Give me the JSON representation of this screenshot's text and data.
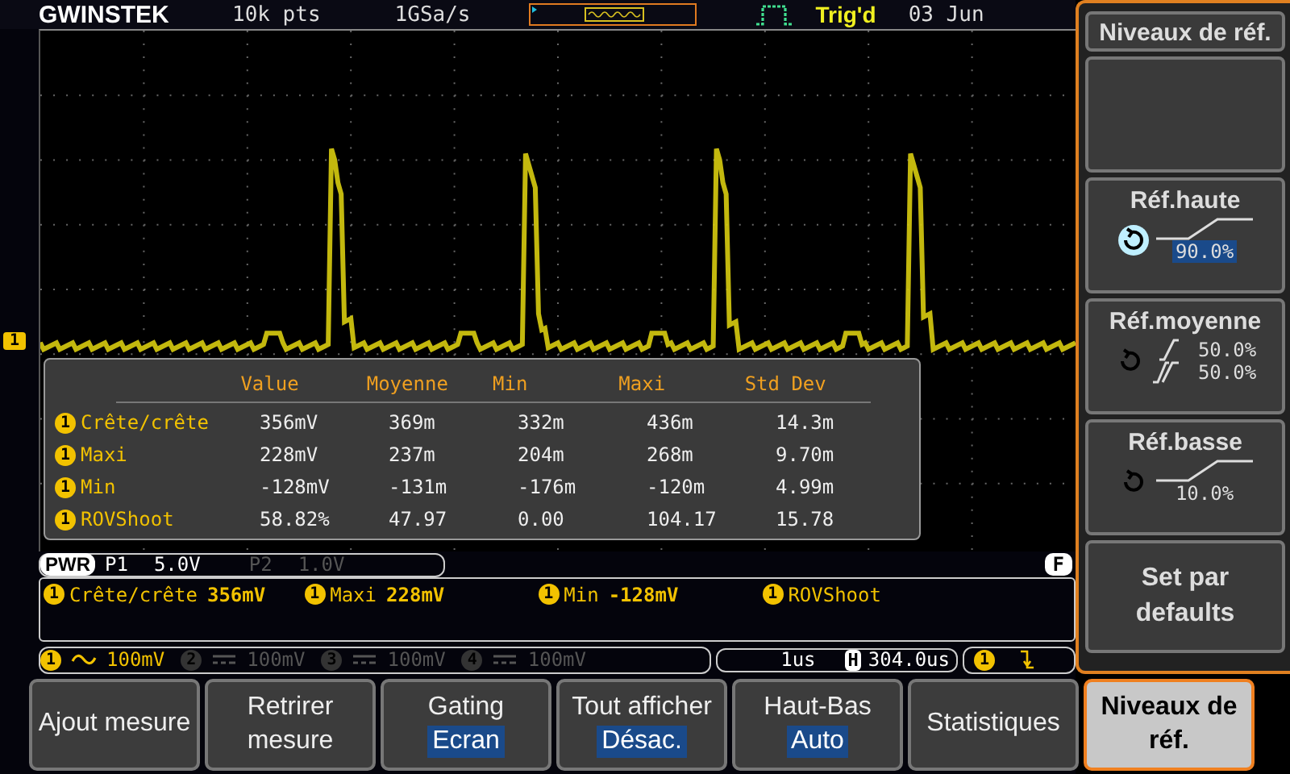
{
  "header": {
    "logo": "GWINSTEK",
    "record": "10k pts",
    "rate": "1GSa/s",
    "trigger_status": "Trig'd",
    "date": "03 Jun"
  },
  "plot": {
    "channel_marker": "1"
  },
  "table": {
    "columns": [
      "Value",
      "Moyenne",
      "Min",
      "Maxi",
      "Std Dev"
    ],
    "rows": [
      {
        "channel": "1",
        "name": "Crête/crête",
        "values": [
          "356mV",
          "369m",
          "332m",
          "436m",
          "14.3m"
        ]
      },
      {
        "channel": "1",
        "name": "Maxi",
        "values": [
          "228mV",
          "237m",
          "204m",
          "268m",
          "9.70m"
        ]
      },
      {
        "channel": "1",
        "name": "Min",
        "values": [
          "-128mV",
          "-131m",
          "-176m",
          "-120m",
          "4.99m"
        ]
      },
      {
        "channel": "1",
        "name": "ROVShoot",
        "values": [
          "58.82%",
          "47.97",
          "0.00",
          "104.17",
          "15.78"
        ]
      }
    ]
  },
  "power": {
    "label": "PWR",
    "probes": [
      {
        "name": "P1",
        "value": "5.0V",
        "disabled": false
      },
      {
        "name": "P2",
        "value": "1.0V",
        "disabled": true
      }
    ],
    "badge": "F"
  },
  "measure_strip": [
    {
      "channel": "1",
      "name": "Crête/crête",
      "value": "356mV"
    },
    {
      "channel": "1",
      "name": "Maxi",
      "value": "228mV"
    },
    {
      "channel": "1",
      "name": "Min",
      "value": "-128mV"
    },
    {
      "channel": "1",
      "name": "ROVShoot"
    }
  ],
  "channels": [
    {
      "number": "1",
      "scale": "100mV",
      "on": true,
      "kind": "ac"
    },
    {
      "number": "2",
      "scale": "100mV",
      "on": false,
      "kind": "dc"
    },
    {
      "number": "3",
      "scale": "100mV",
      "on": false,
      "kind": "dc"
    },
    {
      "number": "4",
      "scale": "100mV",
      "on": false,
      "kind": "dc"
    }
  ],
  "timebase": {
    "scale": "1us",
    "position_label": "H",
    "position": "304.0us"
  },
  "trigger": {
    "channel": "1"
  },
  "side_menu": {
    "title": "Niveaux de réf.",
    "items": [
      {
        "kind": "blank"
      },
      {
        "kind": "level",
        "label": "Réf.haute",
        "value": "90.0%",
        "active": true
      },
      {
        "kind": "dual",
        "label": "Réf.moyenne",
        "values": [
          "50.0%",
          "50.0%"
        ]
      },
      {
        "kind": "level",
        "label": "Réf.basse",
        "value": "10.0%",
        "active": false
      },
      {
        "kind": "action",
        "label": "Set par defaults"
      }
    ]
  },
  "softkeys": [
    {
      "label": "Ajout mesure",
      "selected": false
    },
    {
      "label": "Retrirer mesure",
      "selected": false
    },
    {
      "label": "Gating",
      "value": "Ecran",
      "selected": false
    },
    {
      "label": "Tout afficher",
      "value": "Désac.",
      "selected": false
    },
    {
      "label": "Haut-Bas",
      "value": "Auto",
      "selected": false
    },
    {
      "label": "Statistiques",
      "selected": false
    },
    {
      "label": "Niveaux de réf.",
      "selected": true
    }
  ]
}
